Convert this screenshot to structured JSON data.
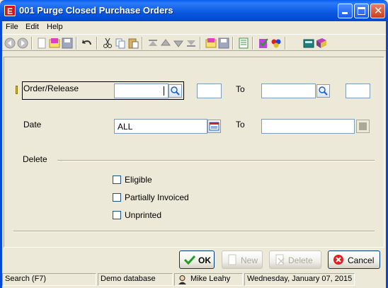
{
  "window": {
    "app_icon_letter": "E",
    "title": "001 Purge Closed Purchase Orders"
  },
  "menu": {
    "file": "File",
    "edit": "Edit",
    "help": "Help"
  },
  "toolbar": {
    "icons": [
      "back-icon",
      "forward-icon",
      "new-icon",
      "open-icon",
      "save-icon",
      "undo-icon",
      "cut-icon",
      "copy-icon",
      "paste-icon",
      "first-icon",
      "previous-icon",
      "next-icon",
      "last-icon",
      "clear-icon",
      "save-record-icon",
      "list-icon",
      "checklist-icon",
      "colors-icon",
      "calculator-icon",
      "book-icon"
    ]
  },
  "form": {
    "order_release_label": "Order/Release",
    "order_from_value": "",
    "order_from_release": "",
    "order_to_label": "To",
    "order_to_value": "",
    "order_to_release": "",
    "date_label": "Date",
    "date_from_value": "ALL",
    "date_to_label": "To",
    "date_to_value": "",
    "delete_label": "Delete",
    "options": [
      {
        "label": "Eligible",
        "checked": false
      },
      {
        "label": "Partially Invoiced",
        "checked": false
      },
      {
        "label": "Unprinted",
        "checked": false
      }
    ]
  },
  "buttons": {
    "ok": "OK",
    "new": "New",
    "delete": "Delete",
    "cancel": "Cancel"
  },
  "status": {
    "hint": "Search (F7)",
    "database": "Demo database",
    "user": "Mike Leahy",
    "date": "Wednesday, January 07, 2015"
  }
}
